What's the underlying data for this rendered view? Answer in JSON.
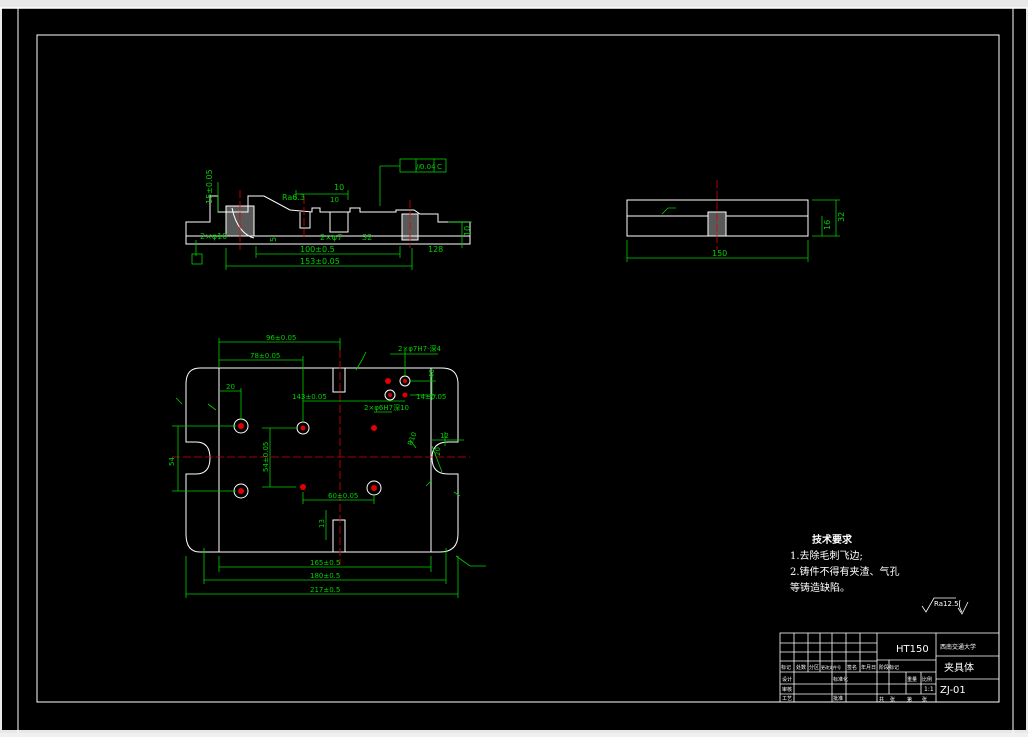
{
  "colors": {
    "background": "#000000",
    "frame": "#ffffff",
    "dimension": "#00d000",
    "centerline": "#e00000",
    "hole": "#e00000",
    "text": "#ffffff",
    "yellow": "#ffff00"
  },
  "front_view": {
    "flatness_frame": {
      "symbol": "//",
      "value": "0.04",
      "datum": "C"
    },
    "dims": {
      "height_15": "15±0.05",
      "ref_63": "Ra6.3",
      "width_10": "10",
      "slot_10": "10",
      "bore": "2×φ7",
      "dia_10": "2×φ10",
      "len_100": "100±0.5",
      "len_153": "153±0.05",
      "right_5": "5",
      "right_10": "10",
      "right_128": "128",
      "dim_32": "32"
    }
  },
  "side_view": {
    "width_label": "150",
    "h1": "16",
    "h2": "32"
  },
  "top_view": {
    "dims": {
      "top_96": "96±0.05",
      "top_78": "78±0.05",
      "top_20": "20",
      "mid_143": "143±0.05",
      "holes_upper_right": "2×φ7H7-深4",
      "holes_mid_right": "2×φ6H7深10",
      "right_40": "40",
      "right_14": "14±0.05",
      "left_54": "54",
      "mid_54": "54±0.05",
      "bottom_60": "60±0.05",
      "right_12": "12",
      "right_r10": "R10",
      "right_20": "20",
      "bottom_165": "165±0.5",
      "bottom_180": "180±0.5",
      "bottom_217": "217±0.5",
      "small_13": "13"
    }
  },
  "notes": {
    "title": "技术要求",
    "lines": [
      "1.去除毛刺飞边;",
      "2.铸件不得有夹渣、气孔",
      "等铸造缺陷。"
    ]
  },
  "roughness": {
    "value": "Ra12.5"
  },
  "title_block": {
    "material": "HT150",
    "school": "西南交通大学",
    "part_name": "夹具体",
    "drawing_no": "ZJ-01",
    "ratio": "1:1",
    "cells": [
      "标记",
      "处数",
      "分区",
      "更改文件号",
      "签名",
      "年月日",
      "设计",
      "标准化",
      "审核",
      "工艺",
      "批准",
      "阶段标记",
      "重量",
      "比例",
      "共",
      "张",
      "第",
      "张"
    ]
  }
}
